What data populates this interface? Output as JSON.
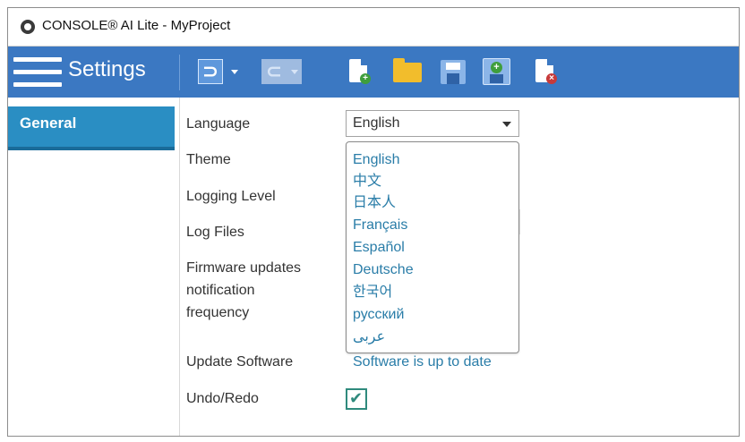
{
  "window": {
    "title": "CONSOLE® AI Lite - MyProject",
    "icon": "console-app-icon"
  },
  "toolbar": {
    "menu_icon": "hamburger-menu-icon",
    "title": "Settings",
    "buttons": [
      {
        "name": "undo",
        "icon": "undo-icon",
        "enabled": true
      },
      {
        "name": "redo",
        "icon": "redo-icon",
        "enabled": false
      },
      {
        "name": "new-project",
        "icon": "new-document-icon"
      },
      {
        "name": "open-project",
        "icon": "folder-icon"
      },
      {
        "name": "save",
        "icon": "save-icon"
      },
      {
        "name": "save-as",
        "icon": "save-as-icon"
      },
      {
        "name": "close-project",
        "icon": "close-document-icon"
      }
    ],
    "colors": {
      "bar": "#3b78c2",
      "folder": "#f2bd2c",
      "add_badge": "#3f9e3c",
      "remove_badge": "#c73a3a"
    }
  },
  "sidebar": {
    "items": [
      {
        "label": "General",
        "selected": true
      }
    ],
    "selected_color": "#2a8ec3"
  },
  "settings": {
    "language_label": "Language",
    "language_value": "English",
    "theme_label": "Theme",
    "logging_level_label": "Logging Level",
    "log_files_label": "Log Files",
    "firmware_label_line1": "Firmware updates",
    "firmware_label_line2": "notification",
    "firmware_label_line3": "frequency",
    "update_software_label": "Update Software",
    "update_software_status": "Software is up to date",
    "undo_redo_label": "Undo/Redo",
    "undo_redo_checked": true
  },
  "language_dropdown": {
    "open": true,
    "options": [
      "English",
      "中文",
      "日本人",
      "Français",
      "Español",
      "Deutsche",
      "한국어",
      "русский",
      "عربى"
    ]
  },
  "colors": {
    "accent_text": "#2a7da8",
    "checkbox": "#2f8a7d"
  }
}
